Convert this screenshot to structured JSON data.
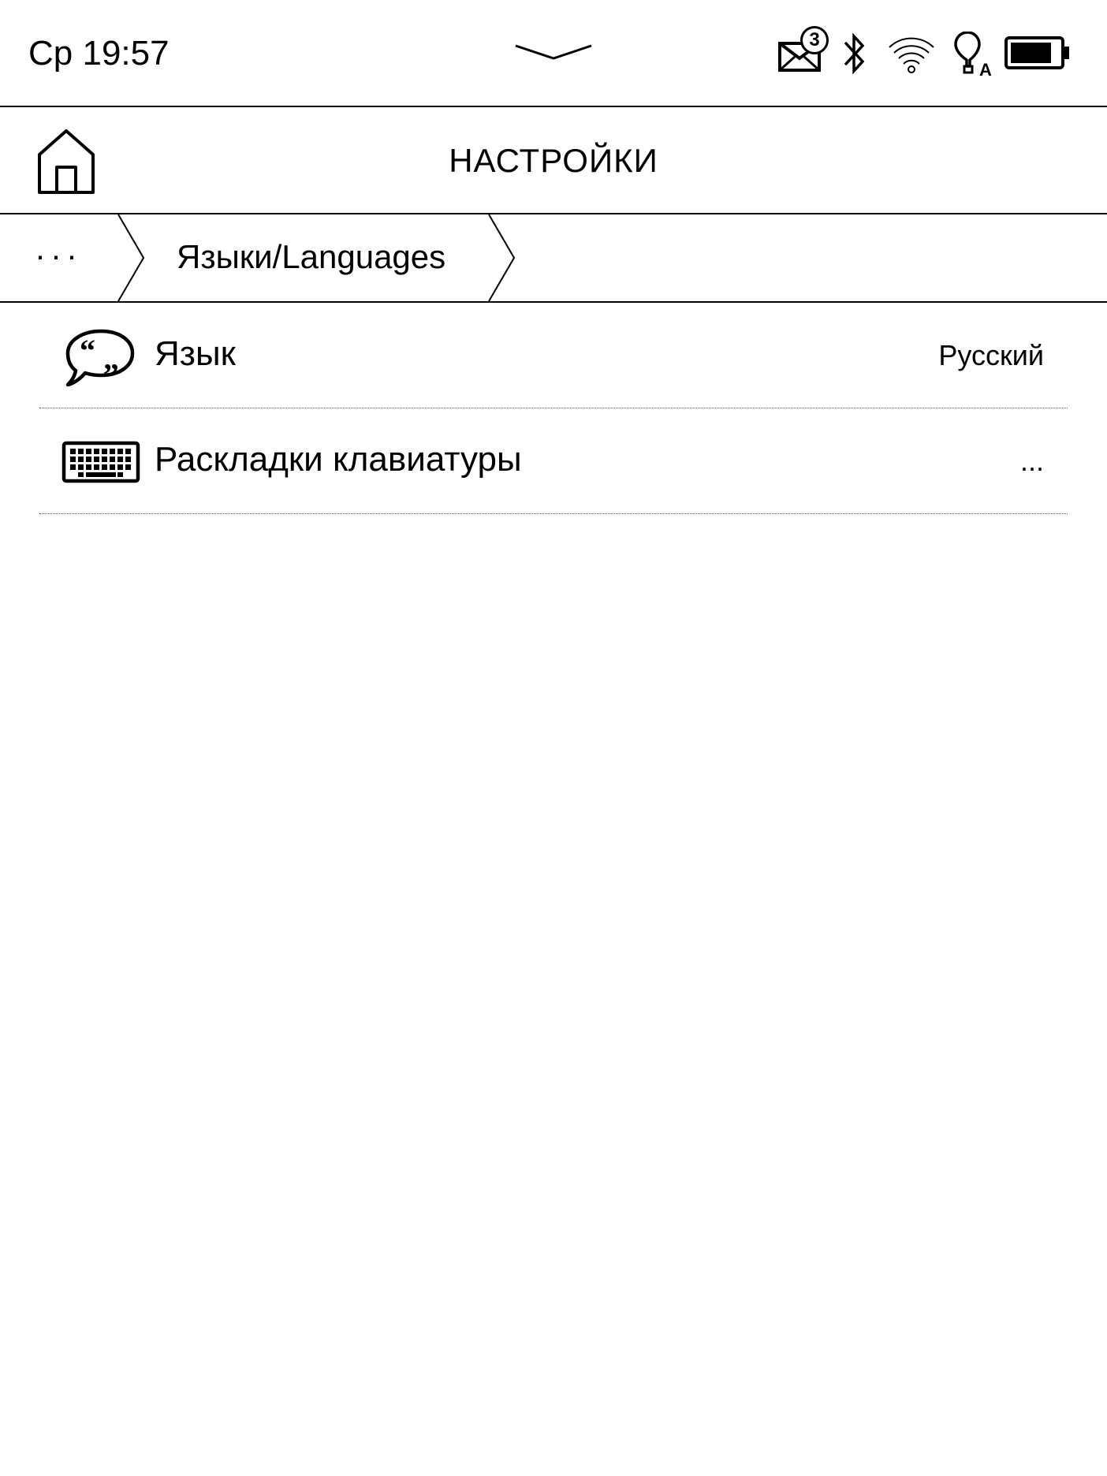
{
  "status_bar": {
    "clock": "Ср 19:57",
    "mail_count": "3",
    "icons": [
      "pull-down-chevron-icon",
      "mail-icon",
      "bluetooth-icon",
      "wifi-icon",
      "auto-light-icon",
      "battery-icon"
    ],
    "auto_light_letter": "A",
    "battery_level": 0.85
  },
  "header": {
    "title": "НАСТРОЙКИ",
    "home_icon": "home-icon"
  },
  "breadcrumb": {
    "more_label": "···",
    "current_label": "Языки/Languages"
  },
  "settings": {
    "items": [
      {
        "icon": "speech-bubble-quotes-icon",
        "label": "Язык",
        "value": "Русский"
      },
      {
        "icon": "keyboard-icon",
        "label": "Раскладки клавиатуры",
        "value": "..."
      }
    ]
  },
  "colors": {
    "foreground": "#000000",
    "background": "#ffffff",
    "divider": "#555555"
  }
}
